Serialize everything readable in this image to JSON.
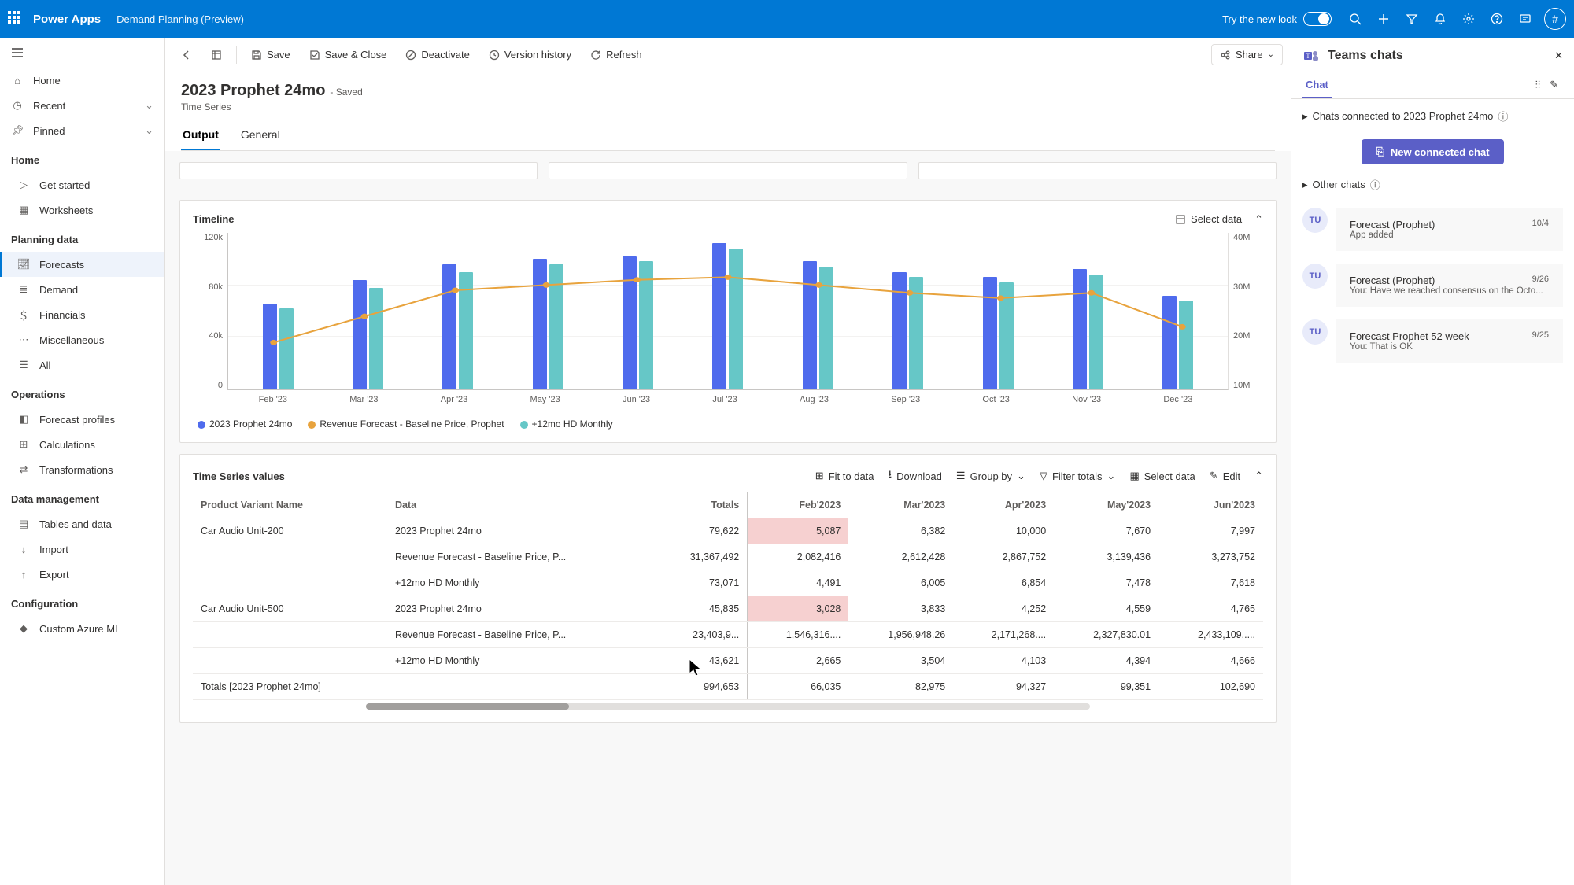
{
  "topbar": {
    "brand": "Power Apps",
    "appname": "Demand Planning (Preview)",
    "tryswitch": "Try the new look",
    "avatar_initial": "#"
  },
  "leftnav": {
    "home": "Home",
    "recent": "Recent",
    "pinned": "Pinned",
    "sections": {
      "home_header": "Home",
      "getstarted": "Get started",
      "worksheets": "Worksheets",
      "planning_header": "Planning data",
      "forecasts": "Forecasts",
      "demand": "Demand",
      "financials": "Financials",
      "misc": "Miscellaneous",
      "all": "All",
      "ops_header": "Operations",
      "profiles": "Forecast profiles",
      "calcs": "Calculations",
      "transforms": "Transformations",
      "data_header": "Data management",
      "tables": "Tables and data",
      "import": "Import",
      "export": "Export",
      "config_header": "Configuration",
      "azure": "Custom Azure ML"
    }
  },
  "cmdbar": {
    "save": "Save",
    "saveclose": "Save & Close",
    "deactivate": "Deactivate",
    "version": "Version history",
    "refresh": "Refresh",
    "share": "Share"
  },
  "record": {
    "title": "2023 Prophet 24mo",
    "state": "- Saved",
    "type": "Time Series",
    "tab_output": "Output",
    "tab_general": "General"
  },
  "timeline": {
    "title": "Timeline",
    "selectdata": "Select data",
    "yleft": [
      "120k",
      "80k",
      "40k",
      "0"
    ],
    "yright": [
      "40M",
      "30M",
      "20M",
      "10M"
    ],
    "legend": [
      "2023 Prophet 24mo",
      "Revenue Forecast - Baseline Price, Prophet",
      "+12mo HD Monthly"
    ]
  },
  "chart_data": {
    "type": "bar",
    "categories": [
      "Feb '23",
      "Mar '23",
      "Apr '23",
      "May '23",
      "Jun '23",
      "Jul '23",
      "Aug '23",
      "Sep '23",
      "Oct '23",
      "Nov '23",
      "Dec '23"
    ],
    "ylim_left": [
      0,
      120000
    ],
    "ylim_right": [
      10000000,
      40000000
    ],
    "series": [
      {
        "name": "2023 Prophet 24mo",
        "axis": "left",
        "type": "bar",
        "values": [
          66000,
          84000,
          96000,
          100000,
          102000,
          112000,
          98000,
          90000,
          86000,
          92000,
          72000
        ]
      },
      {
        "name": "+12mo HD Monthly",
        "axis": "left",
        "type": "bar",
        "values": [
          62000,
          78000,
          90000,
          96000,
          98000,
          108000,
          94000,
          86000,
          82000,
          88000,
          68000
        ]
      },
      {
        "name": "Revenue Forecast - Baseline Price, Prophet",
        "axis": "right",
        "type": "line",
        "values": [
          19000000,
          24000000,
          29000000,
          30000000,
          31000000,
          31500000,
          30000000,
          28500000,
          27500000,
          28500000,
          22000000
        ]
      }
    ],
    "xlabel": "",
    "ylabel_left": "",
    "ylabel_right": ""
  },
  "tsvalues": {
    "title": "Time Series values",
    "fit": "Fit to data",
    "download": "Download",
    "groupby": "Group by",
    "filter": "Filter totals",
    "select": "Select data",
    "edit": "Edit",
    "cols": [
      "Product Variant Name",
      "Data",
      "Totals",
      "Feb'2023",
      "Mar'2023",
      "Apr'2023",
      "May'2023",
      "Jun'2023"
    ],
    "rows": [
      {
        "p": "Car Audio Unit-200",
        "d": "2023 Prophet 24mo",
        "t": "79,622",
        "v": [
          "5,087",
          "6,382",
          "10,000",
          "7,670",
          "7,997"
        ],
        "hl": 0
      },
      {
        "p": "",
        "d": "Revenue Forecast - Baseline Price, P...",
        "t": "31,367,492",
        "v": [
          "2,082,416",
          "2,612,428",
          "2,867,752",
          "3,139,436",
          "3,273,752"
        ]
      },
      {
        "p": "",
        "d": "+12mo HD Monthly",
        "t": "73,071",
        "v": [
          "4,491",
          "6,005",
          "6,854",
          "7,478",
          "7,618"
        ]
      },
      {
        "p": "Car Audio Unit-500",
        "d": "2023 Prophet 24mo",
        "t": "45,835",
        "v": [
          "3,028",
          "3,833",
          "4,252",
          "4,559",
          "4,765"
        ],
        "hl": 0
      },
      {
        "p": "",
        "d": "Revenue Forecast - Baseline Price, P...",
        "t": "23,403,9...",
        "v": [
          "1,546,316....",
          "1,956,948.26",
          "2,171,268....",
          "2,327,830.01",
          "2,433,109....."
        ]
      },
      {
        "p": "",
        "d": "+12mo HD Monthly",
        "t": "43,621",
        "v": [
          "2,665",
          "3,504",
          "4,103",
          "4,394",
          "4,666"
        ]
      }
    ],
    "totals": {
      "label": "Totals [2023 Prophet 24mo]",
      "t": "994,653",
      "v": [
        "66,035",
        "82,975",
        "94,327",
        "99,351",
        "102,690"
      ]
    }
  },
  "chat": {
    "title": "Teams chats",
    "tab": "Chat",
    "connected_label": "Chats connected to 2023 Prophet 24mo",
    "newchat": "New connected chat",
    "other_label": "Other chats",
    "items": [
      {
        "initials": "TU",
        "name": "Forecast (Prophet)",
        "date": "10/4",
        "sub": "App added"
      },
      {
        "initials": "TU",
        "name": "Forecast (Prophet)",
        "date": "9/26",
        "sub": "You: Have we reached consensus on the Octo..."
      },
      {
        "initials": "TU",
        "name": "Forecast Prophet 52 week",
        "date": "9/25",
        "sub": "You: That is OK"
      }
    ]
  }
}
